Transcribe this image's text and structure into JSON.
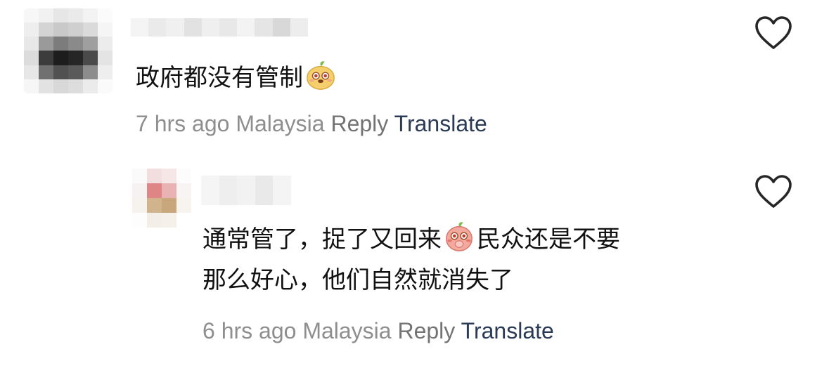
{
  "comments": [
    {
      "text_lines": [
        "政府都没有管制"
      ],
      "time": "7 hrs ago",
      "location": "Malaysia",
      "reply_label": "Reply",
      "translate_label": "Translate",
      "emoji_icon": "bear-face-emoji-icon",
      "like_icon": "heart-outline-icon"
    },
    {
      "text_lines": [
        "通常管了，捉了又回来",
        "民众还是不要",
        "那么好心，他们自然就消失了"
      ],
      "time": "6 hrs ago",
      "location": "Malaysia",
      "reply_label": "Reply",
      "translate_label": "Translate",
      "emoji_icon": "blushing-face-emoji-icon",
      "like_icon": "heart-outline-icon"
    }
  ],
  "colors": {
    "meta_gray": "#8e8e8e",
    "reply_gray": "#737373",
    "translate_blue": "#2b3a55",
    "icon_stroke": "#262626",
    "text": "#111111"
  }
}
